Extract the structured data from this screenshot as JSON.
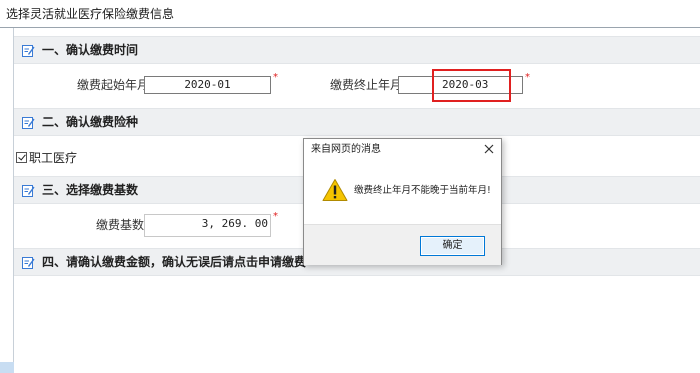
{
  "page": {
    "title": "选择灵活就业医疗保险缴费信息"
  },
  "sections": [
    {
      "title": "一、确认缴费时间",
      "icon": "edit-note-icon"
    },
    {
      "title": "二、确认缴费险种",
      "icon": "edit-note-icon"
    },
    {
      "title": "三、选择缴费基数",
      "icon": "edit-note-icon"
    },
    {
      "title": "四、请确认缴费金额，确认无误后请点击申请缴费",
      "icon": "edit-note-icon"
    }
  ],
  "payment_time": {
    "start_label": "缴费起始年月",
    "start_value": "2020-01",
    "end_label": "缴费终止年月",
    "end_value": "2020-03",
    "required_mark": "*"
  },
  "insurance": {
    "option_label": "职工医疗",
    "checked": true
  },
  "base": {
    "label": "缴费基数",
    "value": "3, 269. 00",
    "required_mark": "*"
  },
  "dialog": {
    "title": "来自网页的消息",
    "message": "缴费终止年月不能晚于当前年月!",
    "ok_label": "确定",
    "icon": "warning-icon"
  },
  "colors": {
    "highlight": "#e02020",
    "section_bg": "#eef0f2",
    "icon_blue": "#3a7bd5",
    "warning": "#f5c400"
  }
}
